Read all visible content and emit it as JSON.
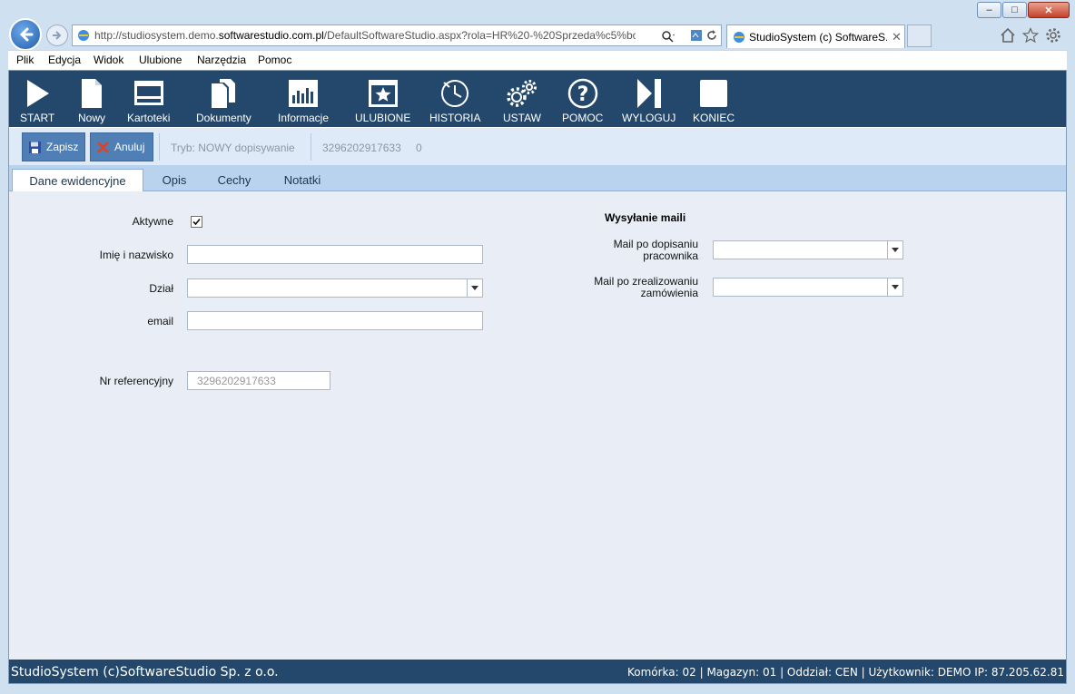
{
  "browser": {
    "address_prefix": "http://studiosystem.demo.",
    "address_domain": "softwarestudio.com.pl",
    "address_rest": "/DefaultSoftwareStudio.aspx?rola=HR%20-%20Sprzeda%c5%bc&rol",
    "tab_title": "StudioSystem (c) SoftwareS...",
    "menu": [
      "Plik",
      "Edycja",
      "Widok",
      "Ulubione",
      "Narzędzia",
      "Pomoc"
    ]
  },
  "toolbar": {
    "items": [
      "START",
      "Nowy",
      "Kartoteki",
      "Dokumenty",
      "Informacje",
      "ULUBIONE",
      "HISTORIA",
      "USTAW",
      "POMOC",
      "WYLOGUJ",
      "KONIEC"
    ]
  },
  "actions": {
    "save_label": "Zapisz",
    "cancel_label": "Anuluj",
    "mode_text": "Tryb: NOWY dopisywanie",
    "record_id": "3296202917633",
    "record_num": "0"
  },
  "tabs": [
    "Dane ewidencyjne",
    "Opis",
    "Cechy",
    "Notatki"
  ],
  "form": {
    "active_label": "Aktywne",
    "active_checked": true,
    "name_label": "Imię i nazwisko",
    "dept_label": "Dział",
    "email_label": "email",
    "ref_label": "Nr referencyjny",
    "ref_value": "3296202917633",
    "mail_section": "Wysyłanie maili",
    "mail_add_label_1": "Mail po dopisaniu",
    "mail_add_label_2": "pracownika",
    "mail_order_label_1": "Mail po zrealizowaniu",
    "mail_order_label_2": "zamówienia"
  },
  "status": {
    "left": "StudioSystem (c)SoftwareStudio Sp. z o.o.",
    "right": "Komórka: 02 | Magazyn: 01 | Oddział: CEN | Użytkownik: DEMO IP: 87.205.62.81"
  }
}
